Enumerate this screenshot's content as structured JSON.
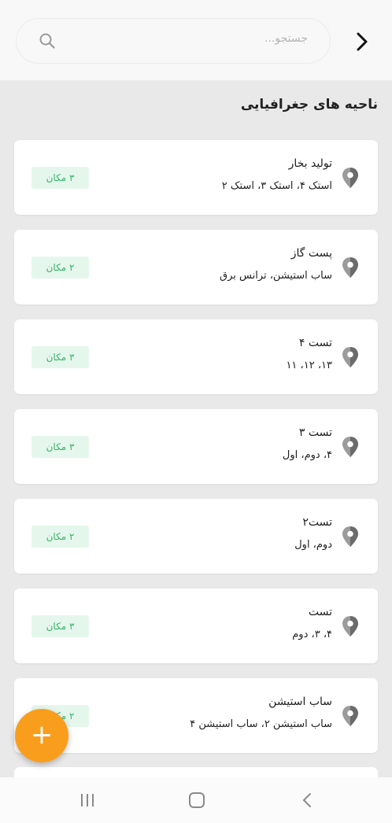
{
  "search": {
    "placeholder": "جستجو..."
  },
  "section_title": "ناحیه های جغرافیایی",
  "regions": [
    {
      "title": "تولید بخار",
      "subtitle": "استک ۴، استک ۳، استک ۲",
      "badge": "۳ مکان"
    },
    {
      "title": "پست گاز",
      "subtitle": "ساب استیشن، ترانس برق",
      "badge": "۲ مکان"
    },
    {
      "title": "تست ۴",
      "subtitle": "۱۳، ۱۲، ۱۱",
      "badge": "۳ مکان"
    },
    {
      "title": "تست ۳",
      "subtitle": "۴، دوم، اول",
      "badge": "۳ مکان"
    },
    {
      "title": "تست۲",
      "subtitle": "دوم، اول",
      "badge": "۲ مکان"
    },
    {
      "title": "تست",
      "subtitle": "۴، ۳، دوم",
      "badge": "۳ مکان"
    },
    {
      "title": "ساب استیشن",
      "subtitle": "ساب استیشن ۲، ساب استیشن ۴",
      "badge": "۲ مکان"
    }
  ],
  "fab_label": "+",
  "colors": {
    "accent": "#f99e1c",
    "badge_bg": "#e5f7ec",
    "badge_text": "#36b56a",
    "background": "#e9e9e9"
  },
  "icons": {
    "back": "chevron-right-icon",
    "search": "search-icon",
    "region": "map-pin-icon",
    "nav_recents": "recents-icon",
    "nav_home": "home-icon",
    "nav_back": "back-icon"
  }
}
